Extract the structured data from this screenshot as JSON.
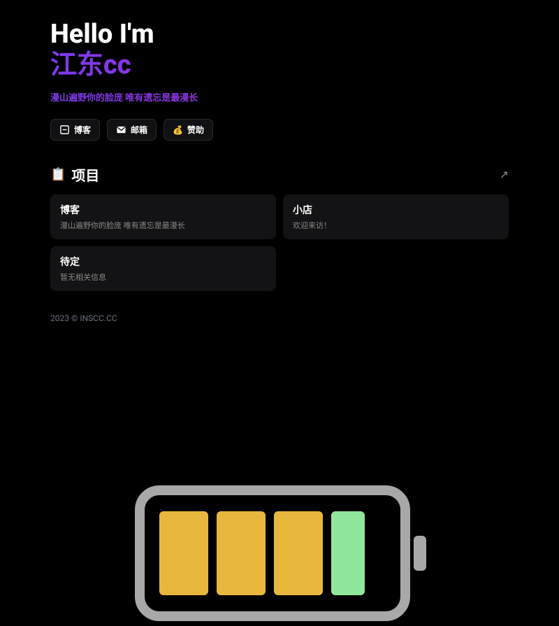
{
  "hero": {
    "greeting": "Hello I'm",
    "name": "江东cc",
    "subtitle": "漫山遍野你的脸庞 唯有遗忘是最漫长"
  },
  "links": [
    {
      "label": "博客",
      "icon": "blog-icon"
    },
    {
      "label": "邮箱",
      "icon": "mail-icon"
    },
    {
      "label": "赞助",
      "icon": "money-icon"
    }
  ],
  "section": {
    "icon": "📋",
    "title": "项目",
    "arrow": "↗"
  },
  "cards": [
    {
      "title": "博客",
      "desc": "漫山遍野你的脸庞 唯有遗忘是最漫长"
    },
    {
      "title": "小店",
      "desc": "欢迎来访！"
    },
    {
      "title": "待定",
      "desc": "暂无相关信息"
    }
  ],
  "footer": {
    "text": "2023 © INSCC.CC"
  }
}
